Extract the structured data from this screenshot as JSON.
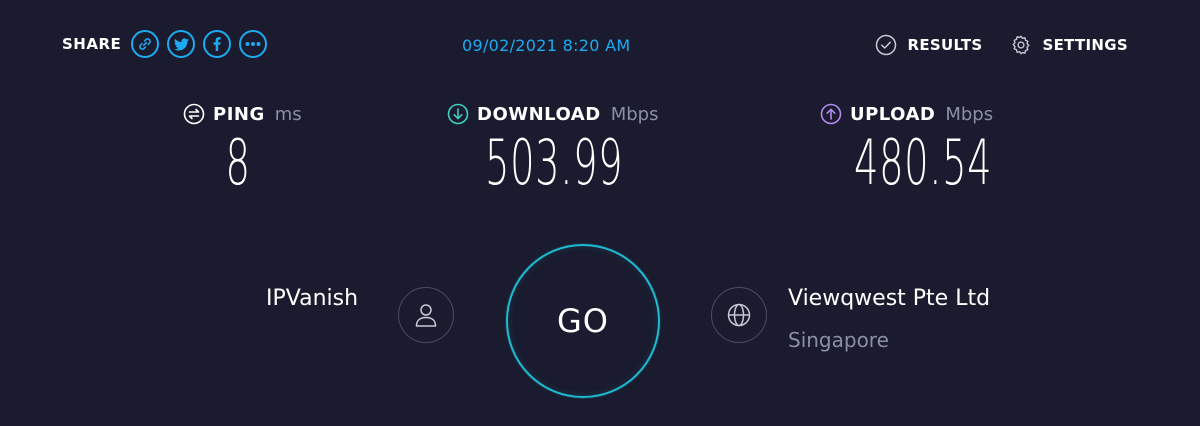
{
  "header": {
    "share_label": "SHARE",
    "share_buttons": [
      {
        "icon": "link-icon"
      },
      {
        "icon": "twitter-icon"
      },
      {
        "icon": "facebook-icon"
      },
      {
        "icon": "more-icon"
      }
    ],
    "timestamp": "09/02/2021 8:20 AM",
    "results_label": "RESULTS",
    "settings_label": "SETTINGS"
  },
  "metrics": {
    "ping": {
      "label": "PING",
      "unit": "ms",
      "value": "8"
    },
    "download": {
      "label": "DOWNLOAD",
      "unit": "Mbps",
      "value": "503.99"
    },
    "upload": {
      "label": "UPLOAD",
      "unit": "Mbps",
      "value": "480.54"
    }
  },
  "go_button": {
    "label": "GO"
  },
  "provider": {
    "name": "IPVanish"
  },
  "server": {
    "name": "Viewqwest Pte Ltd",
    "location": "Singapore"
  },
  "colors": {
    "background": "#1a1b2e",
    "accent_blue": "#1eaaf1",
    "download_teal": "#3fd0c0",
    "upload_purple": "#b38cf0",
    "go_ring": "#1fb9d0",
    "muted_text": "#8c8fa3"
  }
}
